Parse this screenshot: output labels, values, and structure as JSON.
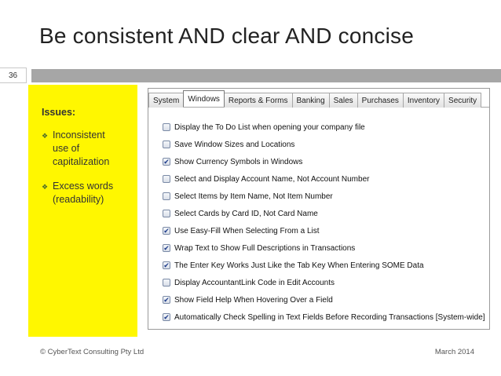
{
  "slide": {
    "title": "Be consistent AND clear AND concise",
    "number": "36",
    "footer_left": "© CyberText Consulting Pty Ltd",
    "footer_right": "March 2014"
  },
  "issues": {
    "label": "Issues:",
    "items": [
      {
        "line1": "Inconsistent",
        "line2": "use of",
        "line3": "capitalization"
      },
      {
        "line1": "Excess words",
        "line2": "(readability)",
        "line3": ""
      }
    ]
  },
  "dialog": {
    "tabs": [
      "System",
      "Windows",
      "Reports & Forms",
      "Banking",
      "Sales",
      "Purchases",
      "Inventory",
      "Security"
    ],
    "active_tab": "Windows",
    "options": [
      {
        "label": "Display the To Do List when opening your company file",
        "checked": false
      },
      {
        "label": "Save Window Sizes and Locations",
        "checked": false
      },
      {
        "label": "Show Currency Symbols in Windows",
        "checked": true
      },
      {
        "label": "Select and Display Account Name, Not Account Number",
        "checked": false
      },
      {
        "label": "Select Items by Item Name, Not Item Number",
        "checked": false
      },
      {
        "label": "Select Cards by Card ID, Not Card Name",
        "checked": false
      },
      {
        "label": "Use Easy-Fill When Selecting From a List",
        "checked": true
      },
      {
        "label": "Wrap Text to Show Full Descriptions in Transactions",
        "checked": true
      },
      {
        "label": "The Enter Key Works Just Like the Tab Key When Entering SOME Data",
        "checked": true
      },
      {
        "label": "Display AccountantLink Code in Edit Accounts",
        "checked": false
      },
      {
        "label": "Show Field Help When Hovering Over a Field",
        "checked": true
      },
      {
        "label": "Automatically Check Spelling in Text Fields Before Recording Transactions [System-wide]",
        "checked": true
      }
    ]
  },
  "colors": {
    "highlight_panel": "#fff700",
    "bar": "#a6a6a6"
  },
  "icons": {
    "bullet": "diamond-bullet-icon",
    "checkbox": "checkmark-icon"
  }
}
